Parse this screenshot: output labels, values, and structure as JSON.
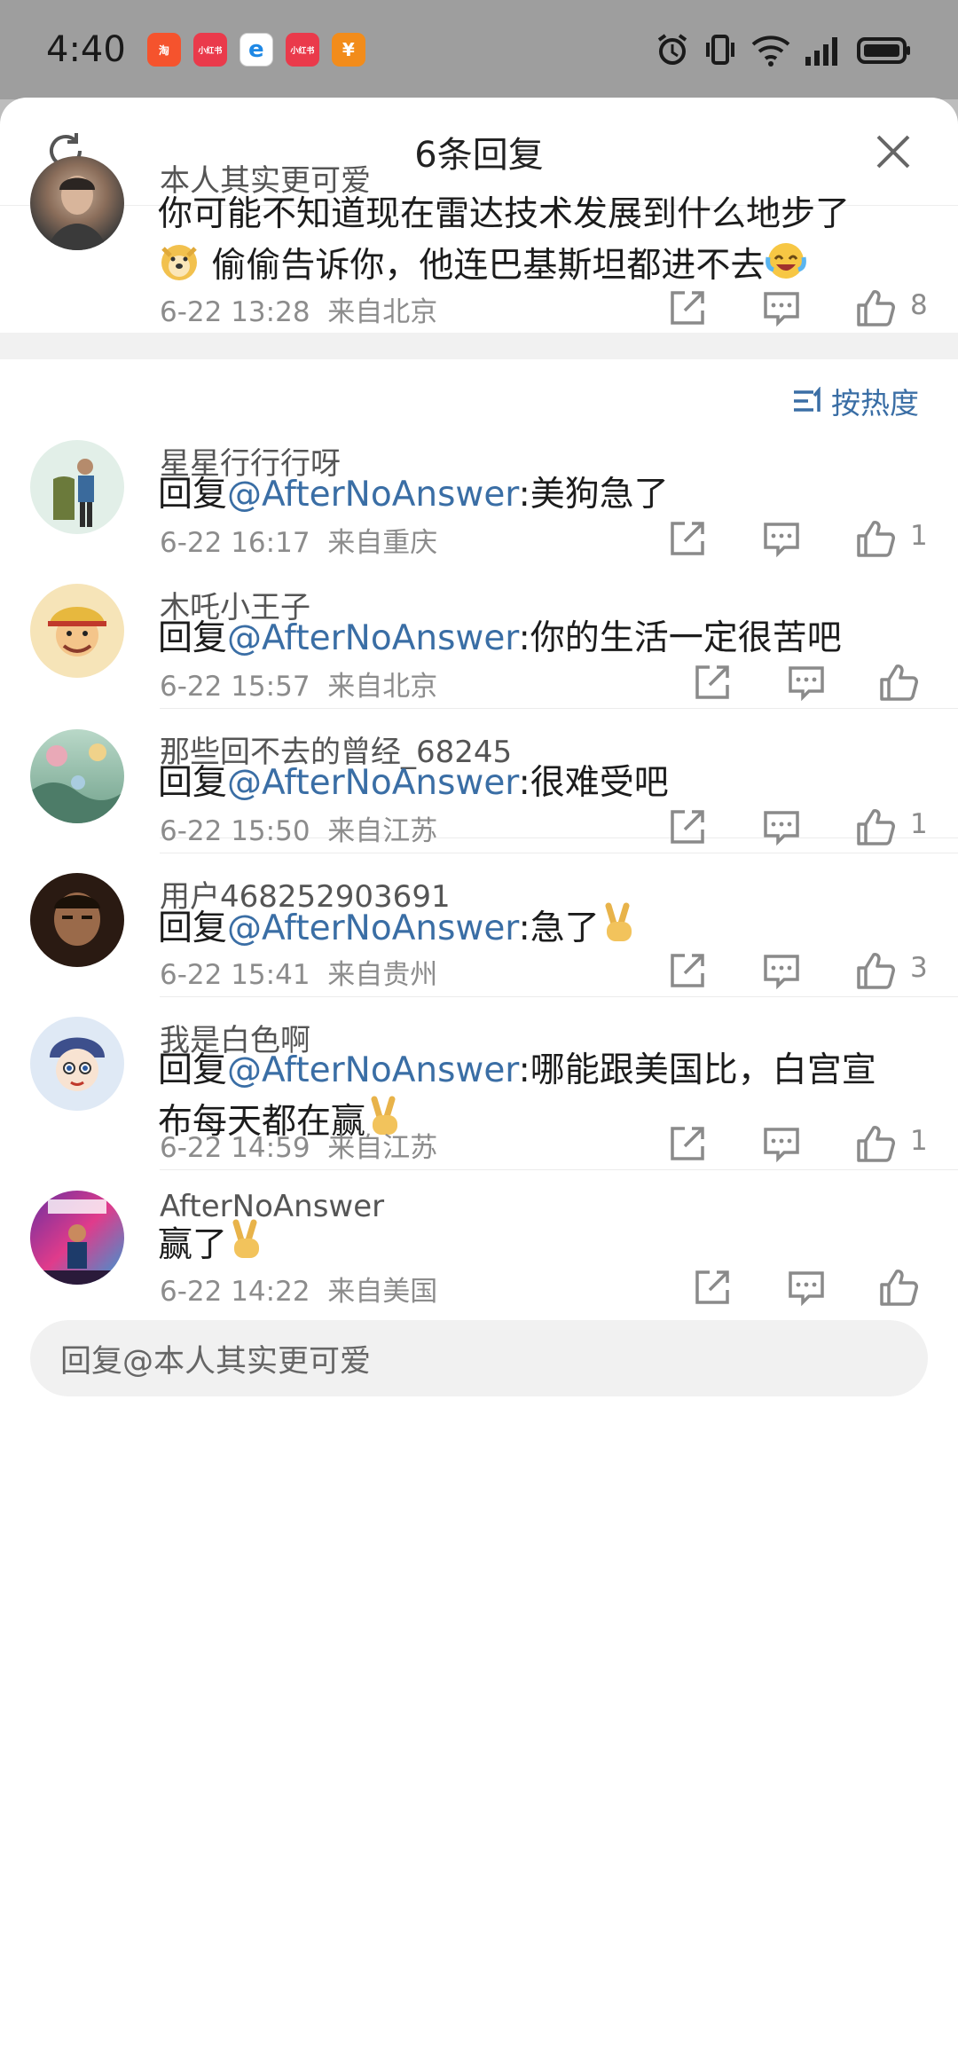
{
  "status_bar": {
    "time": "4:40",
    "apps": [
      {
        "icon": "taobao-icon",
        "color": "#f5532d",
        "label": "淘"
      },
      {
        "icon": "xiaohongshu-icon",
        "color": "#ea3a4b",
        "label": "小红书"
      },
      {
        "icon": "browser-icon",
        "color": "#1e88e5",
        "label": "e"
      },
      {
        "icon": "xiaohongshu-icon",
        "color": "#ea3a4b",
        "label": "小红书"
      },
      {
        "icon": "wallet-icon",
        "color": "#f28c1b",
        "label": "¥"
      }
    ]
  },
  "header": {
    "title": "6条回复"
  },
  "main_comment": {
    "author": "本人其实更可爱",
    "text_line1": "你可能不知道现在雷达技术发展到什么地步了",
    "text_line2": "偷偷告诉你，他连巴基斯坦都进不去",
    "time": "6-22 13:28",
    "location": "来自北京",
    "likes": "8"
  },
  "sort": {
    "label": "按热度"
  },
  "replies": [
    {
      "author": "星星行行行呀",
      "prefix": "回复",
      "mention": "@AfterNoAnswer",
      "text": ":美狗急了",
      "time": "6-22 16:17",
      "location": "来自重庆",
      "likes": "1"
    },
    {
      "author": "木吒小王子",
      "prefix": "回复",
      "mention": "@AfterNoAnswer",
      "text": ":你的生活一定很苦吧",
      "time": "6-22 15:57",
      "location": "来自北京",
      "likes": ""
    },
    {
      "author": "那些回不去的曾经_68245",
      "prefix": "回复",
      "mention": "@AfterNoAnswer",
      "text": ":很难受吧",
      "time": "6-22 15:50",
      "location": "来自江苏",
      "likes": "1"
    },
    {
      "author": "用户468252903691",
      "prefix": "回复",
      "mention": "@AfterNoAnswer",
      "text": ":急了",
      "time": "6-22 15:41",
      "location": "来自贵州",
      "likes": "3"
    },
    {
      "author": "我是白色啊",
      "prefix": "回复",
      "mention": "@AfterNoAnswer",
      "text": ":哪能跟美国比，白宫宣",
      "text2": "布每天都在赢",
      "time": "6-22 14:59",
      "location": "来自江苏",
      "likes": "1"
    },
    {
      "author": "AfterNoAnswer",
      "text": "赢了",
      "time": "6-22 14:22",
      "location": "来自美国",
      "likes": ""
    }
  ],
  "reply_input": {
    "placeholder": "回复@本人其实更可爱"
  },
  "colors": {
    "mention": "#3a6ea5",
    "meta": "#8c8c8c"
  }
}
